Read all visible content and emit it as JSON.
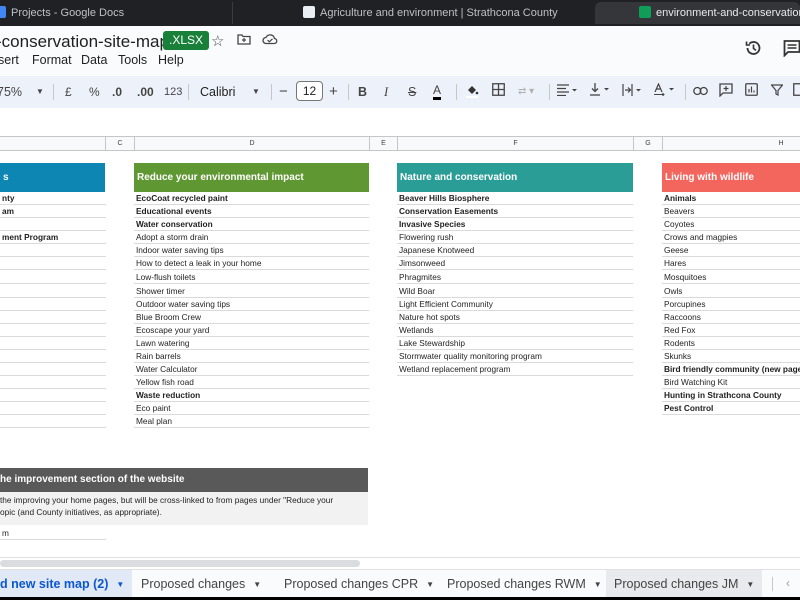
{
  "browser": {
    "tabs": [
      {
        "title": "Projects - Google Docs",
        "icon": "google-docs-icon"
      },
      {
        "title": "Agriculture and environment | Strathcona County",
        "icon": "strathcona-icon"
      },
      {
        "title": "environment-and-conservation-site",
        "icon": "google-sheets-icon",
        "active": true
      }
    ]
  },
  "header": {
    "title": "-conservation-site-map",
    "file_badge": ".XLSX",
    "icons": [
      "star-icon",
      "move-to-folder-icon",
      "cloud-saved-icon",
      "version-history-icon",
      "comments-icon"
    ]
  },
  "menu": [
    "sert",
    "Format",
    "Data",
    "Tools",
    "Help"
  ],
  "toolbar": {
    "zoom": "75%",
    "currency": "£",
    "percent": "%",
    "decrease_decimal": ".0",
    "increase_decimal": ".00",
    "number_format": "123",
    "font": "Calibri",
    "font_size": "12",
    "minus": "−",
    "plus": "+",
    "bold": "B",
    "italic": "I",
    "strike": "S",
    "text_color": "A"
  },
  "columns": [
    "C",
    "D",
    "E",
    "F",
    "G",
    "H"
  ],
  "sections": [
    {
      "title": "s",
      "color": "#0e86b4",
      "items": [
        {
          "text": "nty",
          "bold": true
        },
        {
          "text": "am",
          "bold": true
        },
        {
          "text": "",
          "bold": false
        },
        {
          "text": "ment Program",
          "bold": true
        }
      ]
    },
    {
      "title": "Reduce your environmental impact",
      "color": "#5f9732",
      "items": [
        {
          "text": "EcoCoat recycled paint",
          "bold": true
        },
        {
          "text": "Educational events",
          "bold": true
        },
        {
          "text": "Water conservation",
          "bold": true
        },
        {
          "text": "Adopt a storm drain",
          "bold": false
        },
        {
          "text": "Indoor water saving tips",
          "bold": false
        },
        {
          "text": "How to detect a leak in your home",
          "bold": false
        },
        {
          "text": "Low-flush toilets",
          "bold": false
        },
        {
          "text": "Shower timer",
          "bold": false
        },
        {
          "text": "Outdoor water saving tips",
          "bold": false
        },
        {
          "text": "Blue Broom Crew",
          "bold": false
        },
        {
          "text": "Ecoscape your yard",
          "bold": false
        },
        {
          "text": "Lawn watering",
          "bold": false
        },
        {
          "text": "Rain barrels",
          "bold": false
        },
        {
          "text": "Water Calculator",
          "bold": false
        },
        {
          "text": "Yellow fish road",
          "bold": false
        },
        {
          "text": "Waste reduction",
          "bold": true
        },
        {
          "text": "Eco paint",
          "bold": false
        },
        {
          "text": "Meal plan",
          "bold": false
        }
      ]
    },
    {
      "title": "Nature and conservation",
      "color": "#2b9d97",
      "items": [
        {
          "text": "Beaver Hills Biosphere",
          "bold": true
        },
        {
          "text": "Conservation Easements",
          "bold": true
        },
        {
          "text": "Invasive Species",
          "bold": true
        },
        {
          "text": "Flowering rush",
          "bold": false
        },
        {
          "text": "Japanese Knotweed",
          "bold": false
        },
        {
          "text": "Jimsonweed",
          "bold": false
        },
        {
          "text": "Phragmites",
          "bold": false
        },
        {
          "text": "Wild Boar",
          "bold": false
        },
        {
          "text": "Light Efficient Community",
          "bold": false
        },
        {
          "text": "Nature hot spots",
          "bold": false
        },
        {
          "text": "Wetlands",
          "bold": false
        },
        {
          "text": "Lake Stewardship",
          "bold": false
        },
        {
          "text": "Stormwater quality monitoring program",
          "bold": false
        },
        {
          "text": "Wetland replacement program",
          "bold": false
        }
      ]
    },
    {
      "title": "Living with wildlife",
      "color": "#f2665e",
      "items": [
        {
          "text": "Animals",
          "bold": true
        },
        {
          "text": "Beavers",
          "bold": false
        },
        {
          "text": "Coyotes",
          "bold": false
        },
        {
          "text": "Crows and magpies",
          "bold": false
        },
        {
          "text": "Geese",
          "bold": false
        },
        {
          "text": "Hares",
          "bold": false
        },
        {
          "text": "Mosquitoes",
          "bold": false
        },
        {
          "text": "Owls",
          "bold": false
        },
        {
          "text": "Porcupines",
          "bold": false
        },
        {
          "text": "Raccoons",
          "bold": false
        },
        {
          "text": "Red Fox",
          "bold": false
        },
        {
          "text": "Rodents",
          "bold": false
        },
        {
          "text": "Skunks",
          "bold": false
        },
        {
          "text": "Bird friendly community (new page",
          "bold": true
        },
        {
          "text": "Bird Watching Kit",
          "bold": false
        },
        {
          "text": "Hunting in Strathcona County",
          "bold": true
        },
        {
          "text": "Pest Control",
          "bold": true
        }
      ]
    }
  ],
  "home_improvement": {
    "title": "he improvement section of the website",
    "line1": " the improving your home pages, but will be cross-linked to from pages under \"Reduce your",
    "line2": "opic (and County initiatives, as appropriate).",
    "item": "m"
  },
  "sheet_tabs": [
    {
      "label": "d new site map (2)",
      "active": true
    },
    {
      "label": "Proposed changes",
      "active": false
    },
    {
      "label": "Proposed changes CPR",
      "active": false
    },
    {
      "label": "Proposed changes RWM",
      "active": false
    },
    {
      "label": "Proposed changes JM",
      "active": false
    }
  ]
}
